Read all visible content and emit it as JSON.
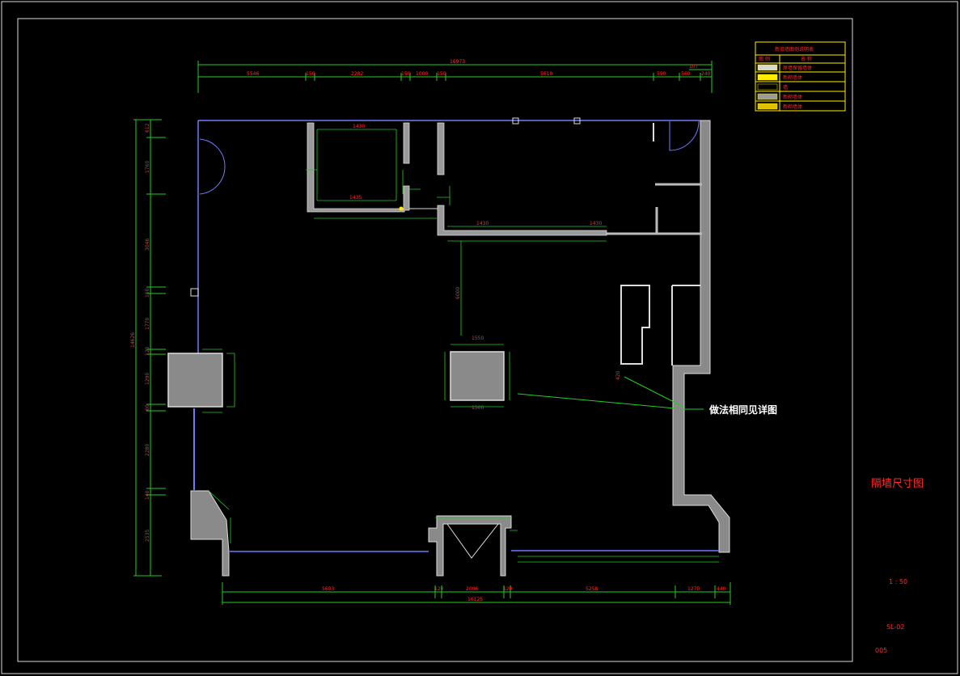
{
  "drawing": {
    "title": "隔墙尺寸图",
    "scale": "1 : 50",
    "sheet_no": "SL-02",
    "page_no": "005",
    "note": "做法相同见详图"
  },
  "legend": {
    "title": "新旧墙图例说明表",
    "head_symbol": "图 例",
    "head_name": "名 称",
    "rows": [
      {
        "label": "原墙保留墙体",
        "swatch": "#d8d8d8"
      },
      {
        "label": "新砌墙体",
        "swatch": "#ffee00"
      },
      {
        "label": "墙",
        "swatch": "#000000"
      },
      {
        "label": "新砌墙体",
        "swatch": "#9a9a9a"
      },
      {
        "label": "新砌墙体",
        "swatch": "#e0c000"
      }
    ]
  },
  "dims": {
    "top_overall": "16973",
    "top_segments": [
      "5546",
      "150",
      "2282",
      "150",
      "1000",
      "150",
      "5610",
      "590",
      "560",
      "240"
    ],
    "top_extra": "107",
    "left_overall": "14626",
    "left_segments": [
      "612",
      "1760",
      "3046",
      "150",
      "1770",
      "120",
      "1290",
      "60",
      "2280",
      "140",
      "2535"
    ],
    "bottom_overall": "16125",
    "bottom_segments": [
      "5603",
      "120",
      "2006",
      "120",
      "5258",
      "1270",
      "440"
    ],
    "inner_labels": [
      "1430",
      "1435",
      "1430",
      "1430",
      "1550",
      "1500",
      "6000",
      "420"
    ]
  }
}
